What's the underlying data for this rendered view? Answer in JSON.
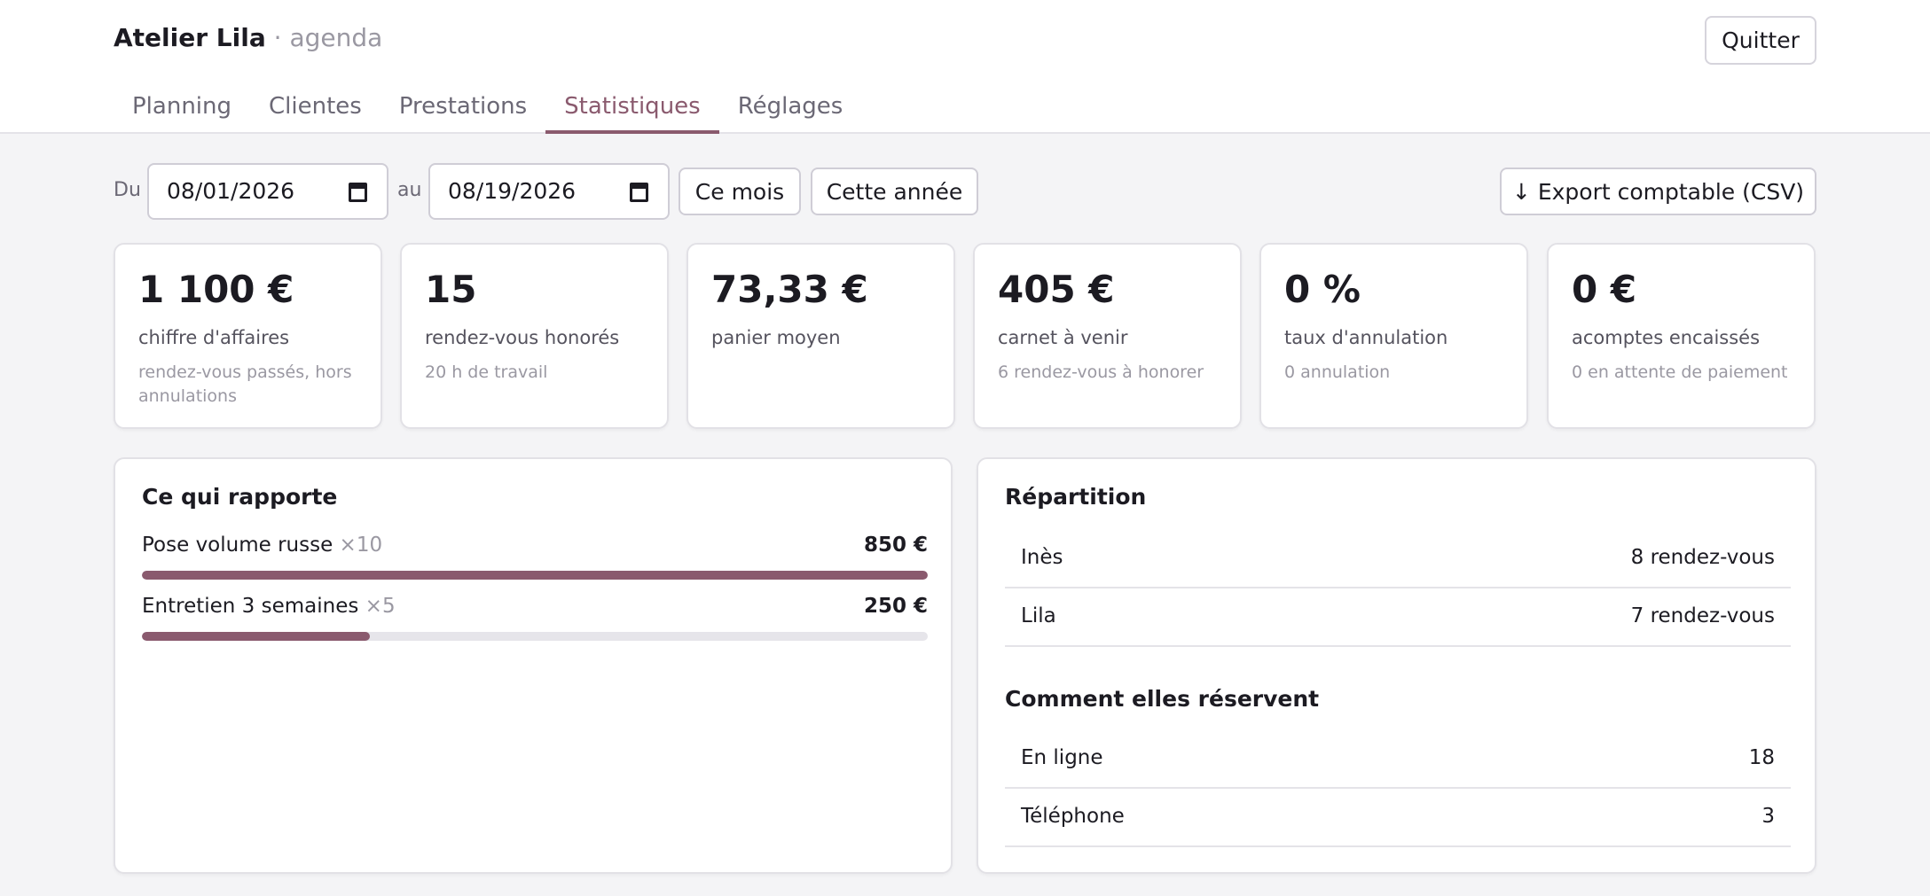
{
  "app": {
    "name": "Atelier Lila",
    "separator": "·",
    "section": "agenda"
  },
  "header": {
    "quit_label": "Quitter"
  },
  "tabs": [
    {
      "label": "Planning"
    },
    {
      "label": "Clientes"
    },
    {
      "label": "Prestations"
    },
    {
      "label": "Statistiques",
      "active": true
    },
    {
      "label": "Réglages"
    }
  ],
  "filters": {
    "from_label": "Du",
    "from_value": "08/01/2026",
    "to_label": "au",
    "to_value": "08/19/2026",
    "this_month_label": "Ce mois",
    "this_year_label": "Cette année",
    "export_label": "↓ Export comptable (CSV)"
  },
  "kpis": [
    {
      "value": "1 100 €",
      "label": "chiffre d'affaires",
      "hint": "rendez-vous passés, hors annulations"
    },
    {
      "value": "15",
      "label": "rendez-vous honorés",
      "hint": "20 h de travail"
    },
    {
      "value": "73,33 €",
      "label": "panier moyen",
      "hint": ""
    },
    {
      "value": "405 €",
      "label": "carnet à venir",
      "hint": "6 rendez-vous à honorer"
    },
    {
      "value": "0 %",
      "label": "taux d'annulation",
      "hint": "0 annulation"
    },
    {
      "value": "0 €",
      "label": "acomptes encaissés",
      "hint": "0 en attente de paiement"
    }
  ],
  "earnings": {
    "title": "Ce qui rapporte",
    "items": [
      {
        "name": "Pose volume russe",
        "count": "×10",
        "amount": "850 €",
        "share": 1.0
      },
      {
        "name": "Entretien 3 semaines",
        "count": "×5",
        "amount": "250 €",
        "share": 0.29
      }
    ]
  },
  "distribution": {
    "title": "Répartition",
    "rows": [
      {
        "name": "Inès",
        "value": "8 rendez-vous"
      },
      {
        "name": "Lila",
        "value": "7 rendez-vous"
      }
    ]
  },
  "booking": {
    "title": "Comment elles réservent",
    "rows": [
      {
        "name": "En ligne",
        "value": "18"
      },
      {
        "name": "Téléphone",
        "value": "3"
      }
    ]
  },
  "colors": {
    "accent": "#8a5a6e",
    "background": "#f4f4f6",
    "track": "#e6e5ea"
  }
}
